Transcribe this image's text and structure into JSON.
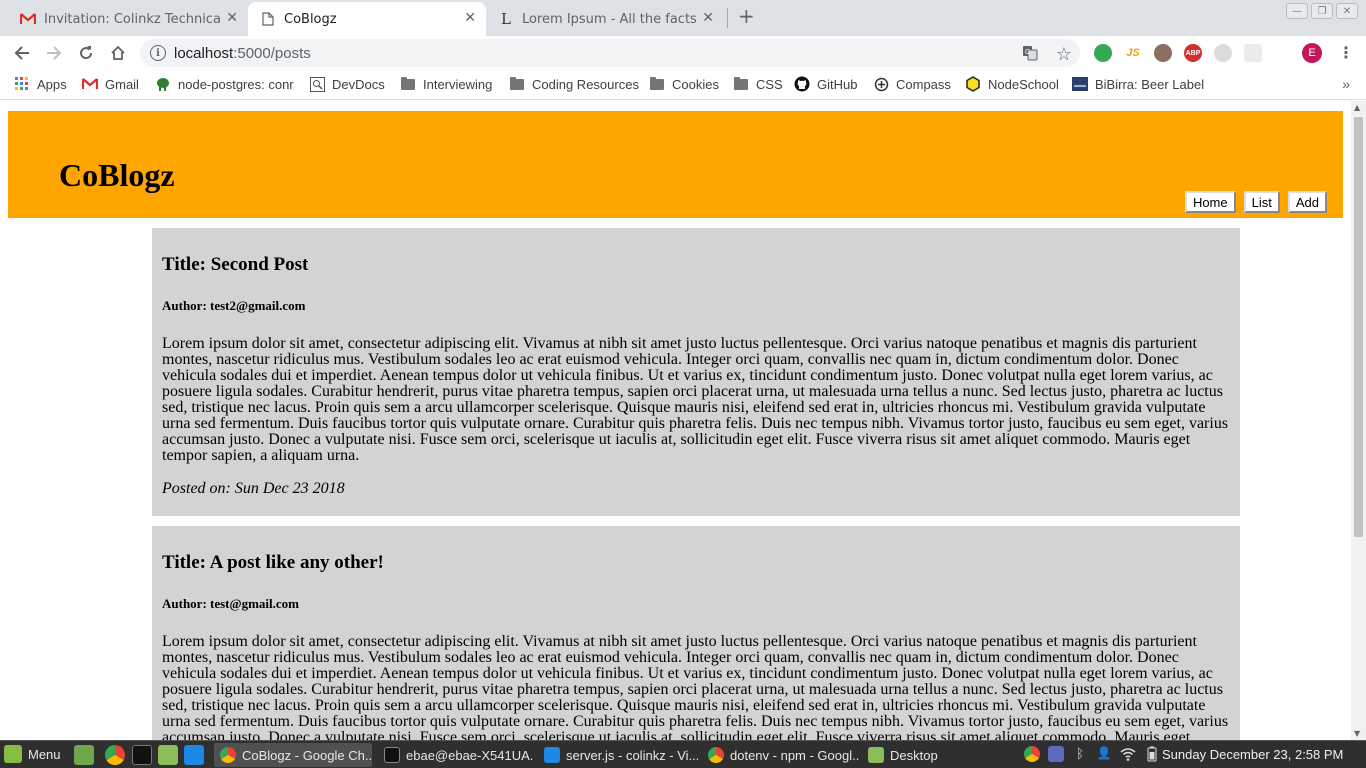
{
  "browser": {
    "tabs": [
      {
        "title": "Invitation: Colinkz Technical Tes",
        "icon": "gmail-icon",
        "active": false
      },
      {
        "title": "CoBlogz",
        "icon": "page-icon",
        "active": true
      },
      {
        "title": "Lorem Ipsum - All the facts - Lip",
        "icon": "lipsum-icon",
        "active": false
      }
    ],
    "url_host": "localhost",
    "url_path": ":5000/posts",
    "profile_initial": "E",
    "bookmarks": [
      {
        "label": "Apps",
        "icon": "apps-grid-icon"
      },
      {
        "label": "Gmail",
        "icon": "gmail-icon"
      },
      {
        "label": "node-postgres: conr",
        "icon": "elephant-icon"
      },
      {
        "label": "DevDocs",
        "icon": "devdocs-icon"
      },
      {
        "label": "Interviewing",
        "icon": "folder-icon"
      },
      {
        "label": "Coding Resources",
        "icon": "folder-icon"
      },
      {
        "label": "Cookies",
        "icon": "folder-icon"
      },
      {
        "label": "CSS",
        "icon": "folder-icon"
      },
      {
        "label": "GitHub",
        "icon": "github-icon"
      },
      {
        "label": "Compass",
        "icon": "compass-icon"
      },
      {
        "label": "NodeSchool",
        "icon": "nodeschool-icon"
      },
      {
        "label": "BiBirra: Beer Label F",
        "icon": "bibirra-icon"
      }
    ],
    "extensions": [
      {
        "name": "refresh-ext-icon",
        "label": "",
        "color": "#34a853"
      },
      {
        "name": "js-ext-icon",
        "label": "JS",
        "color": "#f0a30a"
      },
      {
        "name": "owl-ext-icon",
        "label": "",
        "color": "#8d6e63"
      },
      {
        "name": "adblock-ext-icon",
        "label": "ABP",
        "color": "#d32f2f"
      },
      {
        "name": "grey-ext-icon",
        "label": "",
        "color": "#bdbdbd"
      },
      {
        "name": "grid-ext-icon",
        "label": "",
        "color": "#e0e0e0"
      }
    ]
  },
  "site": {
    "title": "CoBlogz",
    "nav": {
      "home": "Home",
      "list": "List",
      "add": "Add"
    },
    "header_color": "#ffa500"
  },
  "posts": [
    {
      "title": "Title: Second Post",
      "author": "Author: test2@gmail.com",
      "body": "Lorem ipsum dolor sit amet, consectetur adipiscing elit. Vivamus at nibh sit amet justo luctus pellentesque. Orci varius natoque penatibus et magnis dis parturient montes, nascetur ridiculus mus. Vestibulum sodales leo ac erat euismod vehicula. Integer orci quam, convallis nec quam in, dictum condimentum dolor. Donec vehicula sodales dui et imperdiet. Aenean tempus dolor ut vehicula finibus. Ut et varius ex, tincidunt condimentum justo. Donec volutpat nulla eget lorem varius, ac posuere ligula sodales. Curabitur hendrerit, purus vitae pharetra tempus, sapien orci placerat urna, ut malesuada urna tellus a nunc. Sed lectus justo, pharetra ac luctus sed, tristique nec lacus. Proin quis sem a arcu ullamcorper scelerisque. Quisque mauris nisi, eleifend sed erat in, ultricies rhoncus mi. Vestibulum gravida vulputate urna sed fermentum. Duis faucibus tortor quis vulputate ornare. Curabitur quis pharetra felis. Duis nec tempus nibh. Vivamus tortor justo, faucibus eu sem eget, varius accumsan justo. Donec a vulputate nisi. Fusce sem orci, scelerisque ut iaculis at, sollicitudin eget elit. Fusce viverra risus sit amet aliquet commodo. Mauris eget tempor sapien, a aliquam urna.",
      "date": "Posted on: Sun Dec 23 2018"
    },
    {
      "title": "Title: A post like any other!",
      "author": "Author: test@gmail.com",
      "body": "Lorem ipsum dolor sit amet, consectetur adipiscing elit. Vivamus at nibh sit amet justo luctus pellentesque. Orci varius natoque penatibus et magnis dis parturient montes, nascetur ridiculus mus. Vestibulum sodales leo ac erat euismod vehicula. Integer orci quam, convallis nec quam in, dictum condimentum dolor. Donec vehicula sodales dui et imperdiet. Aenean tempus dolor ut vehicula finibus. Ut et varius ex, tincidunt condimentum justo. Donec volutpat nulla eget lorem varius, ac posuere ligula sodales. Curabitur hendrerit, purus vitae pharetra tempus, sapien orci placerat urna, ut malesuada urna tellus a nunc. Sed lectus justo, pharetra ac luctus sed, tristique nec lacus. Proin quis sem a arcu ullamcorper scelerisque. Quisque mauris nisi, eleifend sed erat in, ultricies rhoncus mi. Vestibulum gravida vulputate urna sed fermentum. Duis faucibus tortor quis vulputate ornare. Curabitur quis pharetra felis. Duis nec tempus nibh. Vivamus tortor justo, faucibus eu sem eget, varius accumsan justo. Donec a vulputate nisi. Fusce sem orci, scelerisque ut iaculis at, sollicitudin eget elit. Fusce viverra risus sit amet aliquet commodo. Mauris eget tempor sapien, a aliquam urna.",
      "date": ""
    }
  ],
  "taskbar": {
    "menu_label": "Menu",
    "tasks": [
      {
        "label": "CoBlogz - Google Ch...",
        "icon": "chrome-icon",
        "active": true
      },
      {
        "label": "ebae@ebae-X541UA...",
        "icon": "terminal-icon",
        "active": false
      },
      {
        "label": "server.js - colinkz - Vi...",
        "icon": "vscode-icon",
        "active": false
      },
      {
        "label": "dotenv - npm - Googl...",
        "icon": "chrome-icon",
        "active": false
      },
      {
        "label": "Desktop",
        "icon": "folder-icon",
        "active": false
      }
    ],
    "clock": "Sunday December 23,  2:58 PM"
  }
}
